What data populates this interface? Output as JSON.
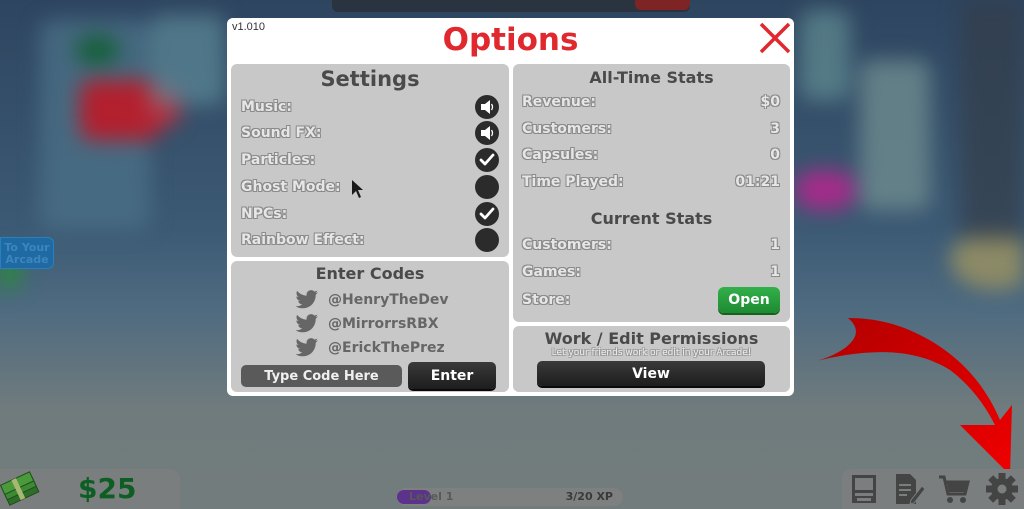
{
  "dialog": {
    "version": "v1.010",
    "title": "Options",
    "close_icon": "close-x-icon"
  },
  "settings": {
    "title": "Settings",
    "items": [
      {
        "label": "Music:",
        "state": "on",
        "icon": "speaker-icon"
      },
      {
        "label": "Sound FX:",
        "state": "on",
        "icon": "speaker-icon"
      },
      {
        "label": "Particles:",
        "state": "checked",
        "icon": "check-icon"
      },
      {
        "label": "Ghost Mode:",
        "state": "unchecked",
        "icon": "empty-circle"
      },
      {
        "label": "NPCs:",
        "state": "checked",
        "icon": "check-icon"
      },
      {
        "label": "Rainbow Effect:",
        "state": "unchecked",
        "icon": "empty-circle"
      }
    ]
  },
  "all_time_stats": {
    "title": "All-Time Stats",
    "rows": [
      {
        "label": "Revenue:",
        "value": "$0"
      },
      {
        "label": "Customers:",
        "value": "3"
      },
      {
        "label": "Capsules:",
        "value": "0"
      },
      {
        "label": "Time Played:",
        "value": "01:21"
      }
    ]
  },
  "current_stats": {
    "title": "Current Stats",
    "rows": [
      {
        "label": "Customers:",
        "value": "1"
      },
      {
        "label": "Games:",
        "value": "1"
      }
    ],
    "store_label": "Store:",
    "store_button": "Open",
    "store_button_color": "#27a03f"
  },
  "codes": {
    "title": "Enter Codes",
    "handles": [
      "@HenryTheDev",
      "@MirrorrsRBX",
      "@ErickThePrez"
    ],
    "input_placeholder": "Type Code Here",
    "input_value": "",
    "enter_button": "Enter"
  },
  "permissions": {
    "title": "Work / Edit Permissions",
    "subtitle": "Let your friends work or edit in your Arcade!",
    "view_button": "View"
  },
  "side_button": {
    "label_line1": "To Your",
    "label_line2": "Arcade"
  },
  "hud": {
    "money": "$25",
    "level": "Level 1",
    "xp": "3/20 XP",
    "xp_progress": 0.15,
    "icons": [
      "arcade-machine-icon",
      "edit-document-icon",
      "shopping-cart-icon",
      "gear-icon"
    ]
  },
  "colors": {
    "title_red": "#e0282e",
    "panel_gray": "#c8c8c8",
    "money_green": "#0e5e24",
    "arrow_red": "#e00000",
    "xp_purple": "#5a2b8e"
  }
}
